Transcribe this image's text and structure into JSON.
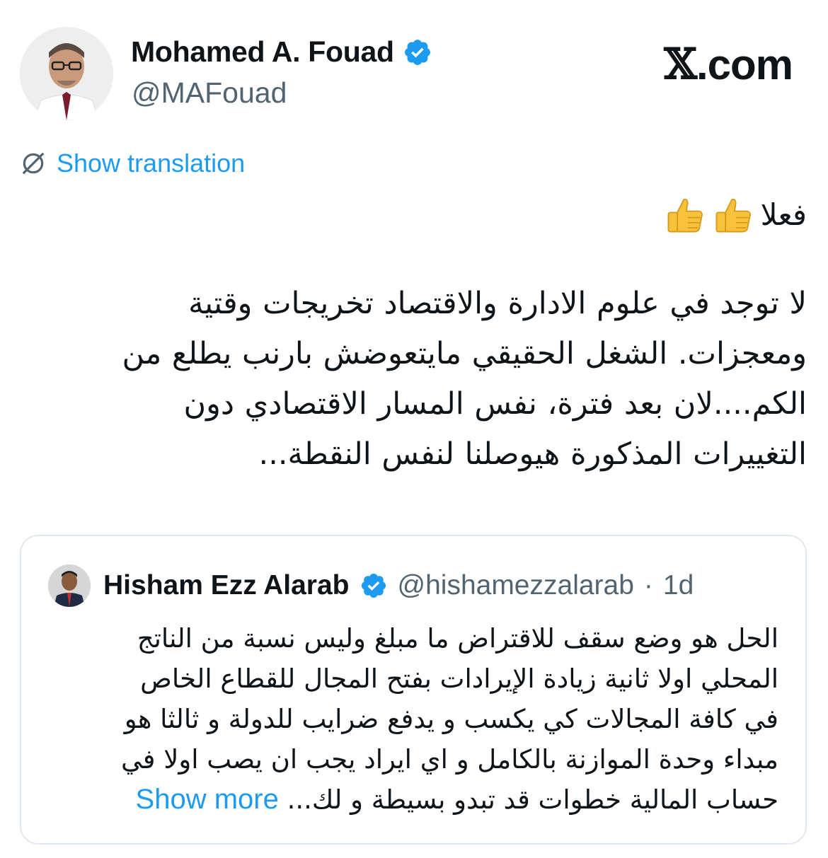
{
  "author": {
    "name": "Mohamed A. Fouad",
    "handle": "@MAFouad",
    "verified_color": "#1d9bf0"
  },
  "brand": {
    "x": "𝕏",
    "suffix": ".com"
  },
  "translate": {
    "icon": "globe-slash-icon",
    "label": "Show translation"
  },
  "tweet": {
    "line1": "فعلا",
    "emoji": [
      "thumbs-up",
      "thumbs-up"
    ],
    "body": "لا توجد في علوم الادارة والاقتصاد تخريجات وقتية\nومعجزات.  الشغل الحقيقي مايتعوضش بارنب يطلع من\nالكم....لان بعد فترة، نفس المسار الاقتصادي دون\nالتغييرات المذكورة هيوصلنا لنفس النقطة..."
  },
  "quote": {
    "name": "Hisham Ezz Alarab",
    "handle": "@hishamezzalarab",
    "separator": "·",
    "time": "1d",
    "text": "الحل هو وضع سقف للاقتراض ما مبلغ وليس نسبة من الناتج\nالمحلي اولا ثانية زيادة الإيرادات بفتح المجال للقطاع الخاص\nفي كافة المجالات كي يكسب و يدفع ضرايب للدولة و ثالثا هو\nمبداء وحدة الموازنة بالكامل و اي ايراد يجب ان يصب اولا في\nحساب المالية خطوات قد تبدو بسيطة و لك...",
    "show_more": "Show more"
  },
  "colors": {
    "link": "#1d9bf0",
    "secondary": "#536471",
    "border": "#e1e8ed"
  }
}
